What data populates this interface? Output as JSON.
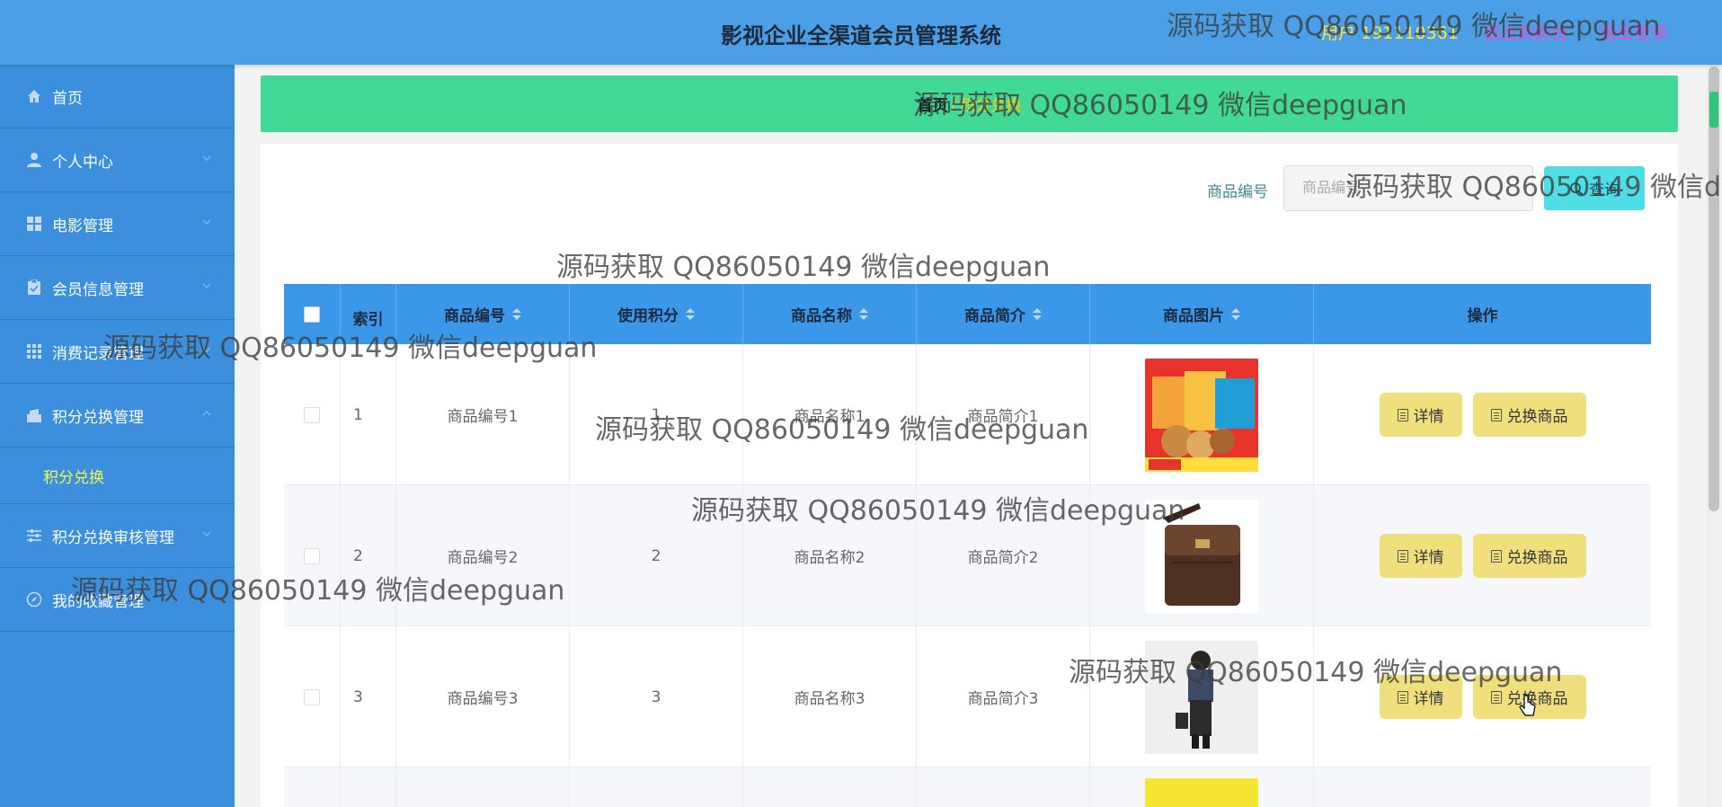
{
  "header": {
    "title": "影视企业全渠道会员管理系统",
    "user_label": "用户 191110361",
    "front_link": "退出到前台",
    "logout_link": "退出登录"
  },
  "sidebar": {
    "items": [
      {
        "label": "首页",
        "icon": "home-icon"
      },
      {
        "label": "个人中心",
        "icon": "user-icon"
      },
      {
        "label": "电影管理",
        "icon": "grid-icon"
      },
      {
        "label": "会员信息管理",
        "icon": "clipboard-icon"
      },
      {
        "label": "消费记录管理",
        "icon": "apps-icon"
      },
      {
        "label": "积分兑换管理",
        "icon": "exchange-icon"
      },
      {
        "label": "积分兑换审核管理",
        "icon": "sliders-icon"
      },
      {
        "label": "我的收藏管理",
        "icon": "compass-icon"
      }
    ],
    "active_sub": "积分兑换"
  },
  "breadcrumb": {
    "home": "首页",
    "separator": "/",
    "current": "积分兑换"
  },
  "search": {
    "label": "商品编号",
    "placeholder": "商品编号",
    "button": "查询"
  },
  "table": {
    "columns": [
      "索引",
      "商品编号",
      "使用积分",
      "商品名称",
      "商品简介",
      "商品图片",
      "操作"
    ],
    "rows": [
      {
        "index": "1",
        "code": "商品编号1",
        "points": "1",
        "name": "商品名称1",
        "intro": "商品简介1",
        "image": "snack-box"
      },
      {
        "index": "2",
        "code": "商品编号2",
        "points": "2",
        "name": "商品名称2",
        "intro": "商品简介2",
        "image": "leather-bag"
      },
      {
        "index": "3",
        "code": "商品编号3",
        "points": "3",
        "name": "商品名称3",
        "intro": "商品简介3",
        "image": "fashion-model"
      }
    ],
    "detail_button": "详情",
    "exchange_button": "兑换商品"
  },
  "watermark": "源码获取 QQ86050149 微信deepguan",
  "colors": {
    "header": "#4a9fe7",
    "sidebar": "#3b8fdc",
    "breadcrumb": "#41d995",
    "table_header": "#3b98e8",
    "action_button": "#f0e07d",
    "search_button": "#4fdde6"
  }
}
